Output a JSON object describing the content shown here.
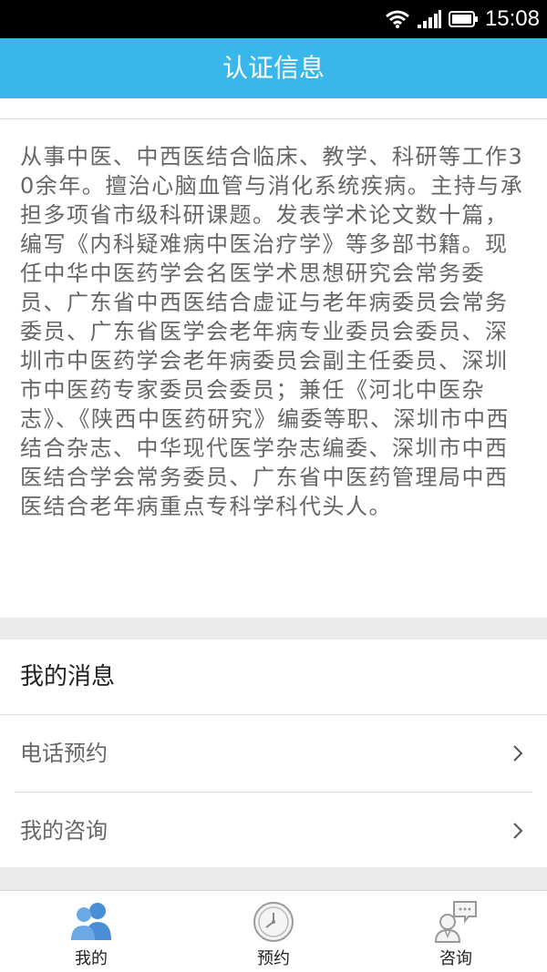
{
  "status_bar": {
    "time": "15:08",
    "icons": [
      "wifi-icon",
      "signal-icon",
      "battery-icon"
    ]
  },
  "header": {
    "title": "认证信息"
  },
  "intro": {
    "text": "从事中医、中西医结合临床、教学、科研等工作30余年。擅治心脑血管与消化系统疾病。主持与承担多项省市级科研课题。发表学术论文数十篇，编写《内科疑难病中医治疗学》等多部书籍。现任中华中医药学会名医学术思想研究会常务委员、广东省中西医结合虚证与老年病委员会常务委员、广东省医学会老年病专业委员会委员、深圳市中医药学会老年病委员会副主任委员、深圳市中医药专家委员会委员；兼任《河北中医杂志》、《陕西中医药研究》编委等职、深圳市中西结合杂志、中华现代医学杂志编委、深圳市中西医结合学会常务委员、广东省中医药管理局中西医结合老年病重点专科学科代头人。"
  },
  "messages": {
    "title": "我的消息",
    "items": [
      {
        "label": "电话预约",
        "icon": "chevron-right-icon"
      },
      {
        "label": "我的咨询",
        "icon": "chevron-right-icon"
      }
    ]
  },
  "tabs": [
    {
      "label": "我的",
      "icon": "people-icon",
      "active": true
    },
    {
      "label": "预约",
      "icon": "clock-icon",
      "active": false
    },
    {
      "label": "咨询",
      "icon": "consult-icon",
      "active": false
    }
  ],
  "colors": {
    "header_bg": "#3ab7ea",
    "active_tab_icon": "#4a8fd6",
    "inactive_tab_icon": "#999999"
  }
}
